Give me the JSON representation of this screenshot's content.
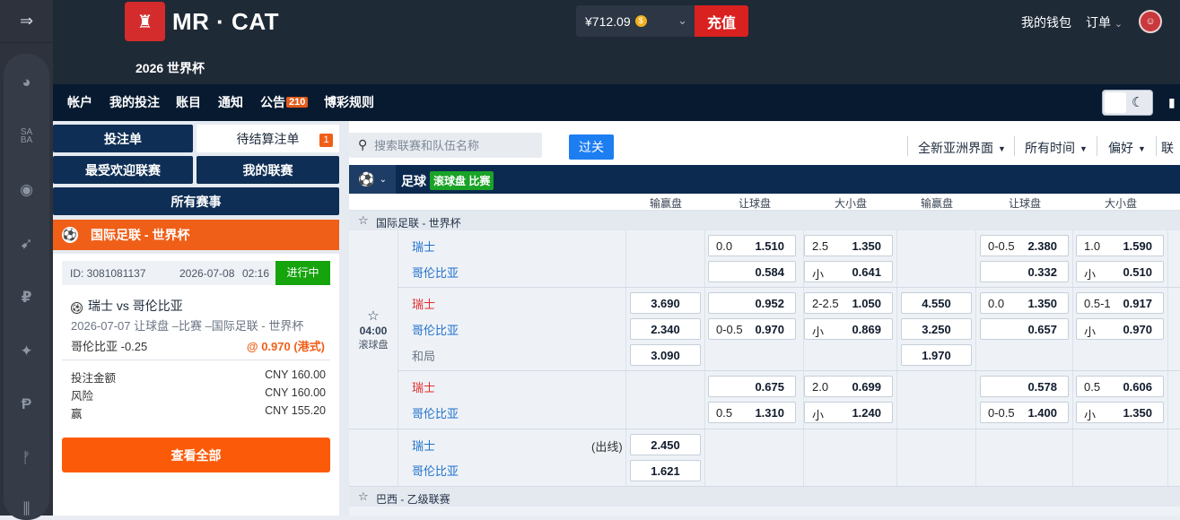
{
  "rail": {
    "icons": [
      "menu-collapse-icon",
      "soccer-ball-icon",
      "saba-icon",
      "basketball-icon",
      "racing-icon",
      "p-icon",
      "tennis-icon",
      "esports-p-icon",
      "f-icon",
      "lines-icon"
    ]
  },
  "header": {
    "brand": "MR · CAT",
    "season": "2026 世界杯",
    "balance": "¥712.09",
    "coin_symbol": "$",
    "topup": "充值",
    "my_wallet": "我的钱包",
    "orders": "订单",
    "orders_caret": "⌄"
  },
  "nav": {
    "items": [
      "帐户",
      "我的投注",
      "账目",
      "通知",
      "公告",
      "博彩规则"
    ],
    "announce_count": "210"
  },
  "left": {
    "tab_betslip": "投注单",
    "tab_pending": "待结算注单",
    "pending_count": "1",
    "popular": "最受欢迎联赛",
    "my_leagues": "我的联赛",
    "all_events": "所有赛事",
    "league_title": "国际足联 - 世界杯",
    "bet": {
      "id": "ID: 3081081137",
      "date": "2026-07-08",
      "time": "02:16",
      "status": "进行中",
      "match": "瑞士  vs  哥伦比亚",
      "desc": "2026-07-07 让球盘 –比赛 –国际足联 - 世界杯",
      "selection": "哥伦比亚  -0.25",
      "odds": "@ 0.970 (港式)",
      "stake_label": "投注金额",
      "stake_value": "CNY 160.00",
      "risk_label": "风险",
      "risk_value": "CNY 160.00",
      "win_label": "赢",
      "win_value": "CNY 155.20"
    },
    "view_all": "查看全部"
  },
  "toolbar": {
    "search_placeholder": "搜索联赛和队伍名称",
    "filter": "过关",
    "view": "全新亚洲界面",
    "time": "所有时间",
    "prefs": "偏好",
    "cut": "联"
  },
  "sportbar": {
    "sport": "足球",
    "tag": "滚球盘 比赛"
  },
  "columns": [
    "输赢盘",
    "让球盘",
    "大小盘",
    "输赢盘",
    "让球盘",
    "大小盘"
  ],
  "leagues": {
    "first": "国际足联 - 世界杯",
    "second": "巴西 - 乙级联赛"
  },
  "event": {
    "time": "04:00",
    "status": "滚球盘",
    "home": "瑞士",
    "away": "哥伦比亚",
    "draw": "和局",
    "outright": "(出线)"
  },
  "odds": {
    "r1": {
      "hcap_ft_home_line": "0.0",
      "hcap_ft_home": "1.510",
      "ou_ft_over_line": "2.5",
      "ou_ft_over": "1.350",
      "hcap_ft_away": "0.584",
      "ou_ft_under_line": "小",
      "ou_ft_under": "0.641",
      "hcap_ht_home_line": "0-0.5",
      "hcap_ht_home": "2.380",
      "ou_ht_over_line": "1.0",
      "ou_ht_over": "1.590",
      "hcap_ht_away": "0.332",
      "ou_ht_under_line": "小",
      "ou_ht_under": "0.510"
    },
    "r2": {
      "ml_home": "3.690",
      "hcap_home": "0.952",
      "ou_over_line": "2-2.5",
      "ou_over": "1.050",
      "ml_away": "2.340",
      "hcap_away_line": "0-0.5",
      "hcap_away": "0.970",
      "ou_under_line": "小",
      "ou_under": "0.869",
      "ml_draw": "3.090",
      "ml_ht_home": "4.550",
      "hcap_ht_home_line": "0.0",
      "hcap_ht_home": "1.350",
      "ou_ht_over_line": "0.5-1",
      "ou_ht_over": "0.917",
      "ml_ht_away": "3.250",
      "hcap_ht_away": "0.657",
      "ou_ht_under_line": "小",
      "ou_ht_under": "0.970",
      "ml_ht_draw": "1.970"
    },
    "r3": {
      "hcap_home": "0.675",
      "ou_over_line": "2.0",
      "ou_over": "0.699",
      "hcap_away_line": "0.5",
      "hcap_away": "1.310",
      "ou_under_line": "小",
      "ou_under": "1.240",
      "hcap_ht_home": "0.578",
      "ou_ht_over_line": "0.5",
      "ou_ht_over": "0.606",
      "hcap_ht_away_line": "0-0.5",
      "hcap_ht_away": "1.400",
      "ou_ht_under_line": "小",
      "ou_ht_under": "1.350"
    },
    "r4": {
      "qualify_home": "2.450",
      "qualify_away": "1.621"
    }
  }
}
